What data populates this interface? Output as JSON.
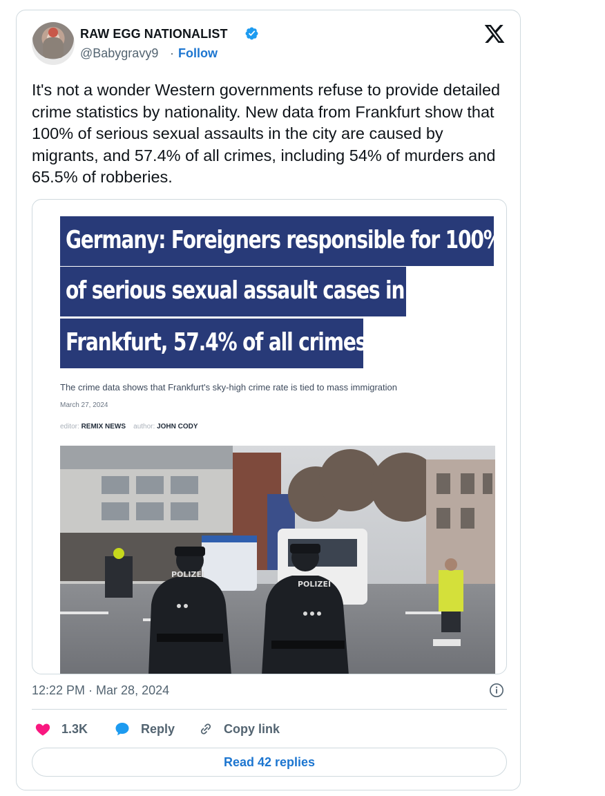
{
  "author": {
    "display_name": "RAW EGG NATIONALIST",
    "handle": "@Babygravy9",
    "separator": "·",
    "follow_label": "Follow"
  },
  "tweet_text": "It's not a wonder Western governments refuse to provide detailed crime statistics by nationality. New data from Frankfurt show that 100% of serious sexual assaults in the city are caused by migrants, and 57.4% of all crimes, including 54% of murders and 65.5% of robberies.",
  "article": {
    "headline_lines": [
      "Germany: Foreigners responsible for 100%",
      "of serious sexual assault cases in",
      "Frankfurt, 57.4% of all crimes"
    ],
    "subheadline": "The crime data shows that Frankfurt's sky-high crime rate is tied to mass immigration",
    "date": "March 27, 2024",
    "editor_label": "editor:",
    "editor": "REMIX NEWS",
    "author_label": "author:",
    "author": "JOHN CODY",
    "photo_text": [
      "POLIZEI",
      "POLIZEI"
    ]
  },
  "timestamp": "12:22 PM · Mar 28, 2024",
  "actions": {
    "likes": "1.3K",
    "reply_label": "Reply",
    "copy_label": "Copy link"
  },
  "read_replies_label": "Read 42 replies",
  "colors": {
    "accent": "#1d76d0",
    "like": "#f91880",
    "headline_bg": "#283a78",
    "secondary_text": "#536471",
    "border": "#cfd9de"
  },
  "icons": [
    "verified-badge-icon",
    "x-logo-icon",
    "info-icon",
    "heart-icon",
    "reply-bubble-icon",
    "link-icon"
  ]
}
